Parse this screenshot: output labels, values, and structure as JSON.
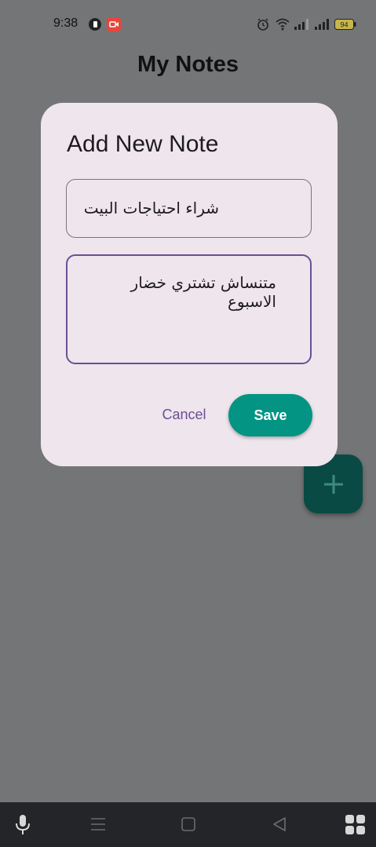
{
  "status_bar": {
    "time": "9:38",
    "battery": "94",
    "icons": [
      "face-unlock-icon",
      "screen-record-icon",
      "alarm-icon",
      "wifi-icon",
      "signal-icon",
      "signal-icon",
      "battery-icon"
    ]
  },
  "app": {
    "title": "My Notes"
  },
  "dialog": {
    "title": "Add New Note",
    "title_field_value": "شراء احتياجات البيت",
    "content_field_value": "متنساش تشتري خضار الاسبوع",
    "cancel_label": "Cancel",
    "save_label": "Save"
  },
  "fab": {
    "icon": "plus-icon"
  },
  "nav_bar": {
    "icons": [
      "microphone-icon",
      "menu-icon",
      "home-square-icon",
      "back-triangle-icon",
      "apps-grid-icon"
    ]
  },
  "colors": {
    "scrim": "#747577",
    "dialog_bg": "#efe5ed",
    "accent_purple": "#6a4f96",
    "save_teal": "#039484",
    "fab_dark": "#094a44",
    "nav_bar": "#232528"
  }
}
